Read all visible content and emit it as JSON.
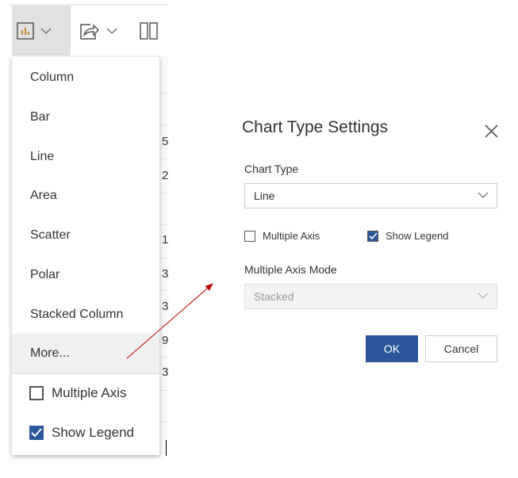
{
  "toolbar": {
    "buttons": [
      {
        "icon": "chart-icon"
      },
      {
        "icon": "share-icon"
      },
      {
        "icon": "columns-icon"
      }
    ]
  },
  "background_table": {
    "digits": [
      "5",
      "2",
      "1",
      "3",
      "3",
      "9",
      "3"
    ]
  },
  "menu": {
    "items": [
      "Column",
      "Bar",
      "Line",
      "Area",
      "Scatter",
      "Polar",
      "Stacked Column",
      "More..."
    ],
    "multiple_axis": {
      "label": "Multiple Axis",
      "checked": false
    },
    "show_legend": {
      "label": "Show Legend",
      "checked": true
    }
  },
  "dialog": {
    "title": "Chart Type Settings",
    "chart_type_label": "Chart Type",
    "chart_type_value": "Line",
    "multiple_axis": {
      "label": "Multiple Axis",
      "checked": false
    },
    "show_legend": {
      "label": "Show Legend",
      "checked": true
    },
    "multiple_axis_mode_label": "Multiple Axis Mode",
    "multiple_axis_mode_value": "Stacked",
    "ok": "OK",
    "cancel": "Cancel"
  },
  "colors": {
    "accent": "#2b579a",
    "arrow": "#c00000"
  }
}
